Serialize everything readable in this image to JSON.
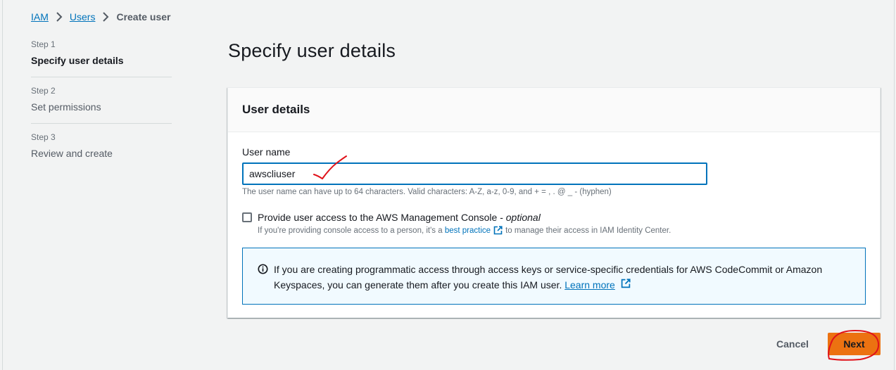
{
  "breadcrumb": {
    "items": [
      "IAM",
      "Users"
    ],
    "current": "Create user"
  },
  "steps": [
    {
      "num": "Step 1",
      "title": "Specify user details",
      "active": true
    },
    {
      "num": "Step 2",
      "title": "Set permissions",
      "active": false
    },
    {
      "num": "Step 3",
      "title": "Review and create",
      "active": false
    }
  ],
  "page": {
    "title": "Specify user details"
  },
  "user_details": {
    "header": "User details",
    "username_label": "User name",
    "username_value": "awscliuser",
    "username_hint": "The user name can have up to 64 characters. Valid characters: A-Z, a-z, 0-9, and + = , . @ _ - (hyphen)",
    "console_access_label": "Provide user access to the AWS Management Console - ",
    "console_access_optional": "optional",
    "console_access_checked": false,
    "console_desc_prefix": "If you're providing console access to a person, it's a ",
    "console_desc_link": "best practice",
    "console_desc_suffix": "to manage their access in IAM Identity Center.",
    "info_text": "If you are creating programmatic access through access keys or service-specific credentials for AWS CodeCommit or Amazon Keyspaces, you can generate them after you create this IAM user. ",
    "info_link": "Learn more"
  },
  "footer": {
    "cancel_label": "Cancel",
    "next_label": "Next"
  },
  "icons": {
    "breadcrumb_separator": "chevron-right-icon",
    "external_link": "external-link-icon",
    "info": "info-icon"
  },
  "colors": {
    "background": "#f2f3f3",
    "link": "#0073bb",
    "primary_button": "#ec7211",
    "info_alert_bg": "#f1faff",
    "annotation": "#e0121a"
  }
}
